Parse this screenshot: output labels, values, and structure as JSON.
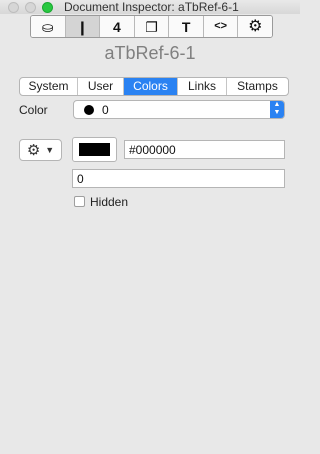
{
  "window": {
    "title": "Document Inspector: aTbRef-6-1"
  },
  "toolbar": {
    "buttons": [
      {
        "name": "general-tab-button",
        "icon": "stamp-icon",
        "glyph": "⛀"
      },
      {
        "name": "note-tab-button",
        "icon": "note-icon",
        "glyph": "❙",
        "active": true
      },
      {
        "name": "number-tab-button",
        "icon": "number-4-icon",
        "glyph": "4"
      },
      {
        "name": "window-tab-button",
        "icon": "window-stack-icon",
        "glyph": "❐"
      },
      {
        "name": "text-tab-button",
        "icon": "text-t-icon",
        "glyph": "T"
      },
      {
        "name": "code-tab-button",
        "icon": "code-brackets-icon",
        "glyph": "<>"
      },
      {
        "name": "settings-tab-button",
        "icon": "gear-icon",
        "glyph": "⚙"
      }
    ]
  },
  "document": {
    "name": "aTbRef-6-1"
  },
  "tabs": [
    {
      "label": "System",
      "active": false
    },
    {
      "label": "User",
      "active": false
    },
    {
      "label": "Colors",
      "active": true
    },
    {
      "label": "Links",
      "active": false
    },
    {
      "label": "Stamps",
      "active": false
    }
  ],
  "color_row": {
    "label": "Color",
    "selected_value": "0",
    "selected_color": "#000000"
  },
  "action_menu": {
    "icon": "gear-icon",
    "chevron": "chevron-down-icon"
  },
  "color_well": {
    "color": "#000000"
  },
  "fields": {
    "hex_value": "#000000",
    "number_value": "0"
  },
  "hidden_checkbox": {
    "label": "Hidden",
    "checked": false
  },
  "colors": {
    "accent": "#2a82f2",
    "background": "#e8e8e8"
  }
}
